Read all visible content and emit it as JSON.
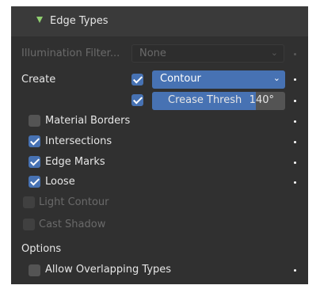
{
  "panel": {
    "title": "Edge Types"
  },
  "illumination": {
    "label": "Illumination Filter...",
    "value": "None"
  },
  "create": {
    "label": "Create",
    "contour_checked": true,
    "contour_value": "Contour",
    "crease_checked": true,
    "crease_label": "Crease Thresh",
    "crease_value": "140°",
    "crease_fill_fraction": 0.78
  },
  "edge_types": [
    {
      "label": "Material Borders",
      "checked": false,
      "enabled": true
    },
    {
      "label": "Intersections",
      "checked": true,
      "enabled": true
    },
    {
      "label": "Edge Marks",
      "checked": true,
      "enabled": true
    },
    {
      "label": "Loose",
      "checked": true,
      "enabled": true
    },
    {
      "label": "Light Contour",
      "checked": false,
      "enabled": false
    },
    {
      "label": "Cast Shadow",
      "checked": false,
      "enabled": false
    }
  ],
  "options": {
    "label": "Options",
    "allow_overlapping_label": "Allow Overlapping Types",
    "allow_overlapping_checked": false
  },
  "colors": {
    "accent": "#4772b3",
    "panel_bg": "#303030",
    "header_arrow": "#8fcf6f"
  },
  "icons": {
    "header": "triangle-down-icon",
    "dropdown": "chevron-down-icon",
    "animate": "keyframe-dot-icon"
  }
}
